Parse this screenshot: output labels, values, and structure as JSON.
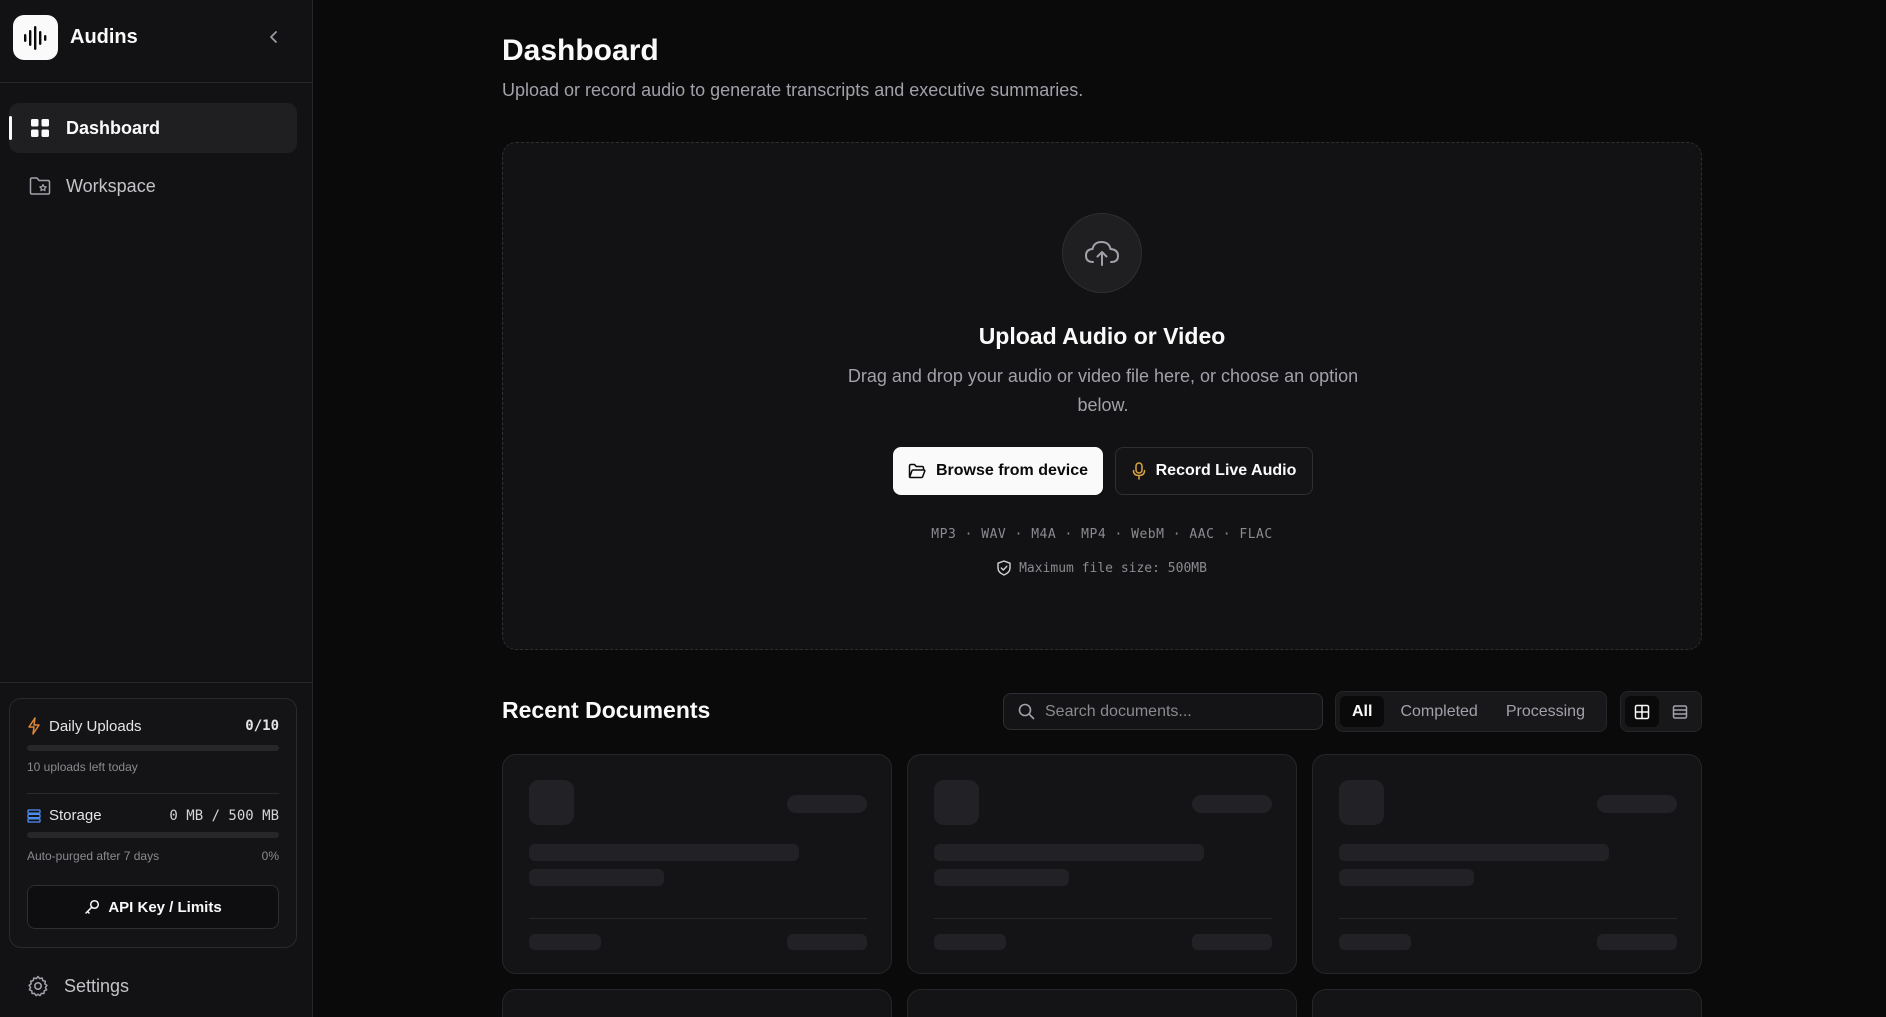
{
  "app": {
    "name": "Audins"
  },
  "sidebar": {
    "items": [
      {
        "label": "Dashboard",
        "icon": "grid-icon",
        "active": true
      },
      {
        "label": "Workspace",
        "icon": "folder-star-icon",
        "active": false
      }
    ],
    "usage": {
      "daily_uploads_label": "Daily Uploads",
      "daily_uploads_value": "0/10",
      "daily_uploads_progress": 0,
      "daily_uploads_sub": "10 uploads left today",
      "storage_label": "Storage",
      "storage_value": "0 MB / 500 MB",
      "storage_progress": 0,
      "storage_sub": "Auto-purged after 7 days",
      "storage_percent": "0%",
      "api_button": "API Key / Limits"
    },
    "settings_label": "Settings"
  },
  "main": {
    "title": "Dashboard",
    "subtitle": "Upload or record audio to generate transcripts and executive summaries.",
    "upload": {
      "title": "Upload Audio or Video",
      "description": "Drag and drop your audio or video file here, or choose an option below.",
      "browse_button": "Browse from device",
      "record_button": "Record Live Audio",
      "formats": "MP3 · WAV · M4A · MP4 · WebM · AAC · FLAC",
      "max_size": "Maximum file size: 500MB"
    },
    "recent": {
      "title": "Recent Documents",
      "search_placeholder": "Search documents...",
      "filters": [
        "All",
        "Completed",
        "Processing"
      ],
      "active_filter": "All",
      "view_mode": "grid"
    }
  },
  "colors": {
    "background": "#0a0a0a",
    "sidebar": "#121214",
    "accent": "#fafafa",
    "mic_accent": "#d9a441",
    "bolt_accent": "#e0873a",
    "storage_accent": "#4f8ff7"
  }
}
